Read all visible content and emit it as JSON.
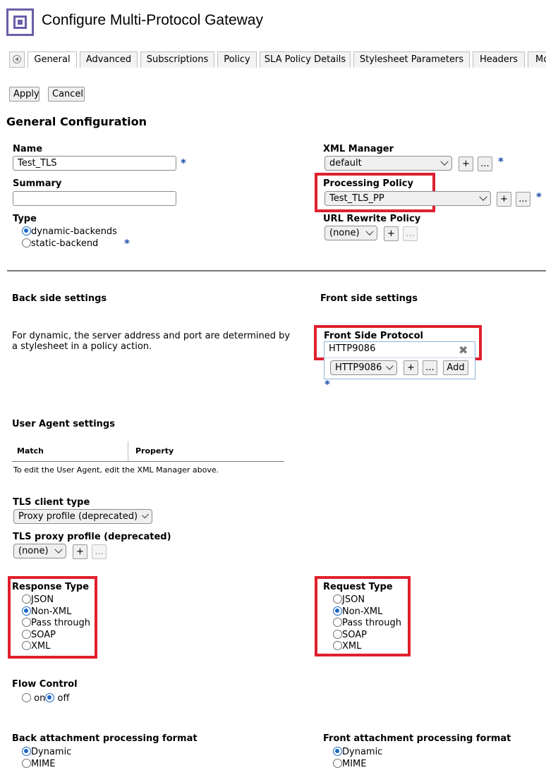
{
  "header": {
    "title": "Configure Multi-Protocol Gateway",
    "logo_icon": "gateway-square-icon"
  },
  "tabs": [
    "General",
    "Advanced",
    "Subscriptions",
    "Policy",
    "SLA Policy Details",
    "Stylesheet Parameters",
    "Headers",
    "Mo"
  ],
  "actions": {
    "apply": "Apply",
    "cancel": "Cancel"
  },
  "section_title": "General Configuration",
  "name": {
    "label": "Name",
    "value": "Test_TLS"
  },
  "summary": {
    "label": "Summary",
    "value": ""
  },
  "type": {
    "label": "Type",
    "options": [
      "dynamic-backends",
      "static-backend"
    ],
    "selected": "dynamic-backends"
  },
  "xml_manager": {
    "label": "XML Manager",
    "value": "default"
  },
  "processing_policy": {
    "label": "Processing Policy",
    "value": "Test_TLS_PP"
  },
  "url_rewrite": {
    "label": "URL Rewrite Policy",
    "value": "(none)"
  },
  "buttons": {
    "plus": "+",
    "dots": "...",
    "add": "Add",
    "required": "*"
  },
  "back_side": {
    "title": "Back side settings",
    "note": "For dynamic, the server address and port are determined by a stylesheet in a policy action."
  },
  "front_side": {
    "title": "Front side settings",
    "protocol_label": "Front Side Protocol",
    "protocol_value": "HTTP9086",
    "select_value": "HTTP9086"
  },
  "user_agent": {
    "title": "User Agent settings",
    "columns": [
      "Match",
      "Property"
    ],
    "note": "To edit the User Agent, edit the XML Manager above."
  },
  "tls_client_type": {
    "label": "TLS client type",
    "value": "Proxy profile (deprecated)"
  },
  "tls_proxy_profile": {
    "label": "TLS proxy profile (deprecated)",
    "value": "(none)"
  },
  "response_type": {
    "label": "Response Type",
    "options": [
      "JSON",
      "Non-XML",
      "Pass through",
      "SOAP",
      "XML"
    ],
    "selected": "Non-XML"
  },
  "request_type": {
    "label": "Request Type",
    "options": [
      "JSON",
      "Non-XML",
      "Pass through",
      "SOAP",
      "XML"
    ],
    "selected": "Non-XML"
  },
  "flow_control": {
    "label": "Flow Control",
    "options": [
      "on",
      "off"
    ],
    "selected": "off"
  },
  "back_attachment": {
    "label": "Back attachment processing format",
    "options": [
      "Dynamic",
      "MIME"
    ],
    "selected": "Dynamic"
  },
  "front_attachment": {
    "label": "Front attachment processing format",
    "options": [
      "Dynamic",
      "MIME"
    ],
    "selected": "Dynamic"
  },
  "colors": {
    "highlight": "#e0202c",
    "accent": "#1a66c8",
    "logo": "#6b5ea8"
  }
}
